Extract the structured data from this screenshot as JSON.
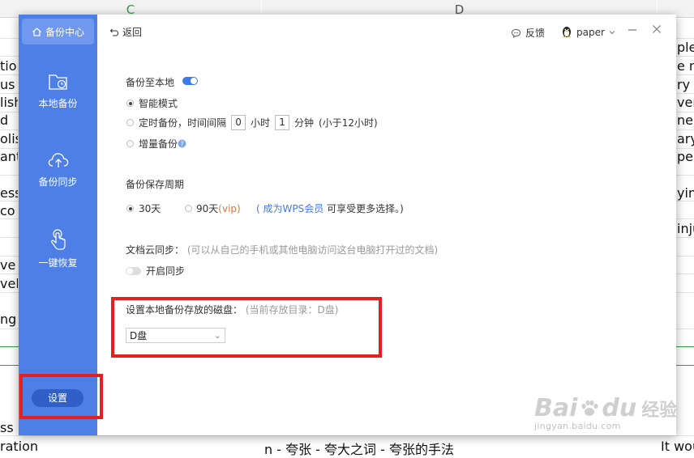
{
  "spreadsheet": {
    "columns": [
      {
        "label": "C",
        "selected": true
      },
      {
        "label": "D",
        "selected": false
      }
    ],
    "left_cells": [
      "tion",
      "us",
      "lish",
      "d",
      "olish",
      "ant",
      "ess",
      " co",
      "ve",
      "vel",
      "ng",
      "ss",
      "ration"
    ],
    "right_cells": [
      "ple",
      "e na",
      "ry s",
      "ver",
      "ne",
      "ary",
      "pers",
      "yin",
      "inju",
      "It wou"
    ],
    "bottom_cell": "n - 夸张 - 夸大之词 - 夸张的手法"
  },
  "dialog": {
    "sidebar": {
      "header": "备份中心",
      "items": [
        {
          "label": "本地备份",
          "icon": "folder-clock-icon"
        },
        {
          "label": "备份同步",
          "icon": "cloud-upload-icon"
        },
        {
          "label": "一键恢复",
          "icon": "hand-tap-icon"
        }
      ],
      "settings_label": "设置"
    },
    "topbar": {
      "back_label": "返回",
      "feedback_label": "反馈",
      "user_name": "paper"
    },
    "local_backup": {
      "title": "备份至本地",
      "enabled": true,
      "smart_mode": "智能模式",
      "timed_backup_prefix": "定时备份，时间间隔",
      "hours_value": "0",
      "hours_unit": "小时",
      "minutes_value": "1",
      "minutes_unit": "分钟",
      "limit_note": "(小于12小时)",
      "incremental": "增量备份"
    },
    "retention": {
      "title": "备份保存周期",
      "option_30": "30天",
      "option_90": "90天",
      "vip_tag": "(vip)",
      "note_open": "(",
      "member_link": "成为WPS会员",
      "note_rest": "可享受更多选择。)"
    },
    "cloud_sync": {
      "title": "文档云同步：",
      "note": "(可以从自己的手机或其他电脑访问这台电脑打开过的文档)",
      "toggle_label": "开启同步"
    },
    "disk": {
      "title": "设置本地备份存放的磁盘：",
      "current_dir": "(当前存放目录：D盘)",
      "selected": "D盘"
    }
  },
  "watermark": {
    "brand": "Bai",
    "brand2": "du",
    "cn": "经验",
    "url": "jingyan.baidu.com"
  },
  "colors": {
    "sidebar": "#4d7fe6",
    "accent": "#3d7be8",
    "highlight_box": "#e62020"
  }
}
